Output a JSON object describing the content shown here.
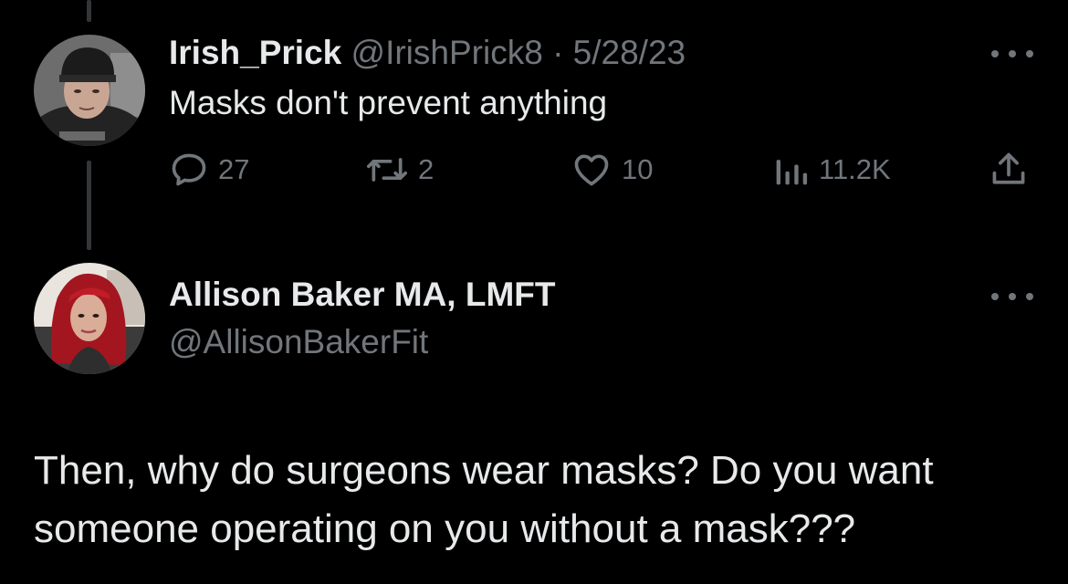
{
  "colors": {
    "background": "#000000",
    "primary_text": "#e7e9ea",
    "secondary_text": "#71767b",
    "thread_line": "#333639"
  },
  "original_tweet": {
    "display_name": "Irish_Prick",
    "handle": "@IrishPrick8",
    "separator": "·",
    "date": "5/28/23",
    "text": "Masks don't prevent anything",
    "avatar_icon": "profile-photo-man-beanie",
    "more_icon": "more-dots-icon",
    "stats": {
      "replies": "27",
      "retweets": "2",
      "likes": "10",
      "views": "11.2K"
    }
  },
  "reply_tweet": {
    "display_name": "Allison Baker MA, LMFT",
    "handle": "@AllisonBakerFit",
    "avatar_icon": "profile-photo-woman-red-hair",
    "more_icon": "more-dots-icon",
    "text": "Then, why do surgeons wear masks? Do you want someone operating on you without a mask???"
  }
}
